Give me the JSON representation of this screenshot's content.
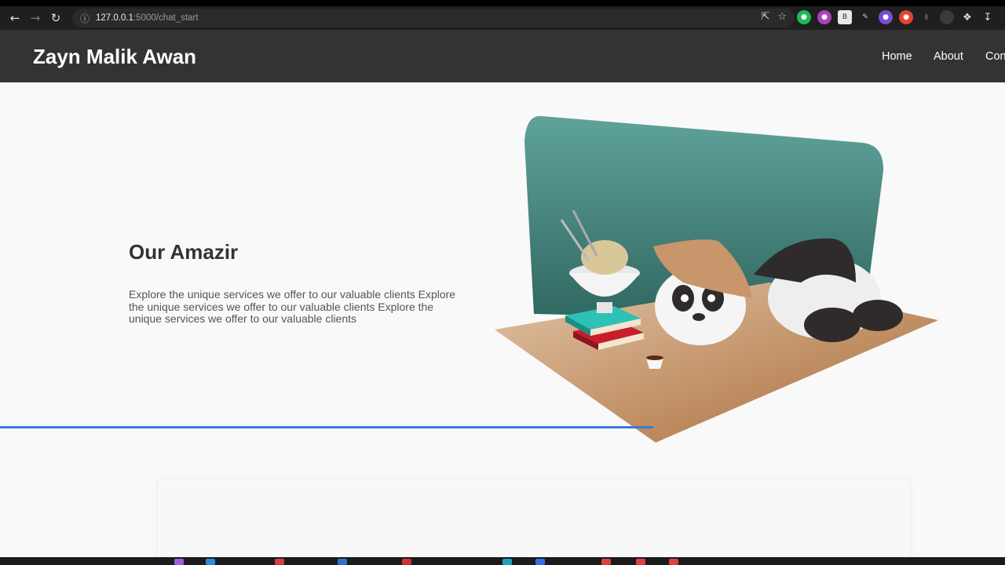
{
  "browser": {
    "url_host": "127.0.0.1",
    "url_path": ":5000/chat_start"
  },
  "site": {
    "brand": "Zayn Malik Awan",
    "nav": [
      "Home",
      "About",
      "Con"
    ]
  },
  "hero": {
    "title": "Our Amazir",
    "text": "Explore the unique services we offer to our valuable clients Explore the unique services we offer to our valuable clients Explore the unique services we offer to our valuable clients"
  },
  "colors": {
    "header_bg": "#333333",
    "progress": "#3c78d8",
    "teal": "#5a9f97"
  },
  "progress": {
    "percent": 65
  }
}
